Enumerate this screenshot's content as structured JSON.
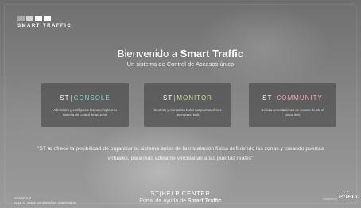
{
  "logo": {
    "text": "SMART TRAFFIC"
  },
  "hero": {
    "welcome_prefix": "Bienvenido a",
    "welcome_brand": "Smart Traffic",
    "subtitle": "Un sistema de Control de Accesos único"
  },
  "cards": [
    {
      "st": "ST",
      "sep": "|",
      "module": "CONSOLE",
      "color": "#7fd3c9",
      "desc": "Administra y configurate forma completa tu sistema de control de accesos"
    },
    {
      "st": "ST",
      "sep": "|",
      "module": "MONITOR",
      "color": "#c7df8a",
      "desc": "Controla y monitoriza todas tus puertas desde un entorno web"
    },
    {
      "st": "ST",
      "sep": "|",
      "module": "COMMUNITY",
      "color": "#f2a7b6",
      "desc": "Solicita acreditaciones de acceso desde el portal web"
    }
  ],
  "quote": "\"ST te ofrece la posibilidad de organizar tu sistema antes de la instalación física definiendo las zonas y creando puertas virtuales, para más adelante vincularlas a las puertas reales\"",
  "help": {
    "st": "ST",
    "sep": "|",
    "label": "HELP CENTER",
    "sub_prefix": "Portal de ayuda de",
    "sub_brand": "Smart Traffic"
  },
  "footer": {
    "version": "versión 1.0",
    "copyright": "2018 © Todos los derechos reservados",
    "powered": "Powered by",
    "brand": "eneca"
  }
}
